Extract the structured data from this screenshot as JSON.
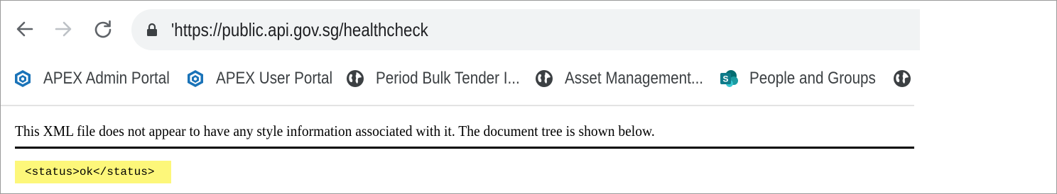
{
  "browser": {
    "address_bar": {
      "url": "'https://public.api.gov.sg/healthcheck"
    },
    "bookmarks": [
      {
        "label": "APEX Admin Portal",
        "icon": "apex-icon"
      },
      {
        "label": "APEX User Portal",
        "icon": "apex-icon"
      },
      {
        "label": "Period Bulk Tender I...",
        "icon": "globe-icon"
      },
      {
        "label": "Asset Management...",
        "icon": "globe-icon"
      },
      {
        "label": "People and Groups",
        "icon": "sharepoint-icon"
      },
      {
        "label": "",
        "icon": "globe-icon"
      }
    ]
  },
  "page": {
    "xml_info": "This XML file does not appear to have any style information associated with it. The document tree is shown below.",
    "xml_tree": {
      "open_tag": "<status>",
      "text": "ok",
      "close_tag": "</status>"
    }
  },
  "colors": {
    "omnibox_bg": "#f1f3f4",
    "highlight": "#fdf77a",
    "apex_blue": "#1a73b8",
    "sharepoint_teal": "#0f7b8a"
  }
}
